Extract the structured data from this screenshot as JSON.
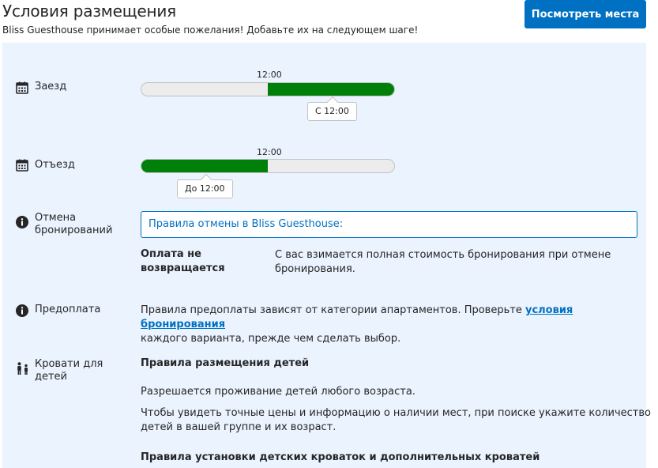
{
  "header": {
    "title": "Условия размещения",
    "subtitle": "Bliss Guesthouse принимает особые пожелания! Добавьте их на следующем шаге!",
    "cta_label": "Посмотреть места"
  },
  "checkin": {
    "label": "Заезд",
    "time_label": "12:00",
    "tooltip": "С 12:00",
    "icon": "calendar-icon",
    "fill_start_fraction": 0.5,
    "fill_end_fraction": 1.0
  },
  "checkout": {
    "label": "Отъезд",
    "time_label": "12:00",
    "tooltip": "До 12:00",
    "icon": "calendar-icon",
    "fill_start_fraction": 0.0,
    "fill_end_fraction": 0.5
  },
  "cancellation": {
    "label_line1": "Отмена",
    "label_line2": "бронирований",
    "icon": "info-icon",
    "box_text": "Правила отмены в Bliss Guesthouse:",
    "policy_title_line1": "Оплата не",
    "policy_title_line2": "возвращается",
    "policy_text_line1": "С вас взимается полная стоимость бронирования при отмене",
    "policy_text_line2": "бронирования."
  },
  "prepayment": {
    "label": "Предоплата",
    "icon": "info-icon",
    "text_before_link": "Правила предоплаты зависят от категории апартаментов. Проверьте ",
    "link_text": "условия бронирования",
    "text_line2": "каждого варианта, прежде чем сделать выбор."
  },
  "children": {
    "label_line1": "Кровати для",
    "label_line2": "детей",
    "icon": "family-icon",
    "rules_title": "Правила размещения детей",
    "rule1": "Разрешается проживание детей любого возраста.",
    "rule2_line1": "Чтобы увидеть точные цены и информацию о наличии мест, при поиске укажите количество",
    "rule2_line2": "детей в вашей группе и их возраст.",
    "beds_title": "Правила установки детских кроваток и дополнительных кроватей"
  },
  "colors": {
    "accent": "#0071c2",
    "fill": "#008009",
    "panel": "#ebf3ff"
  }
}
